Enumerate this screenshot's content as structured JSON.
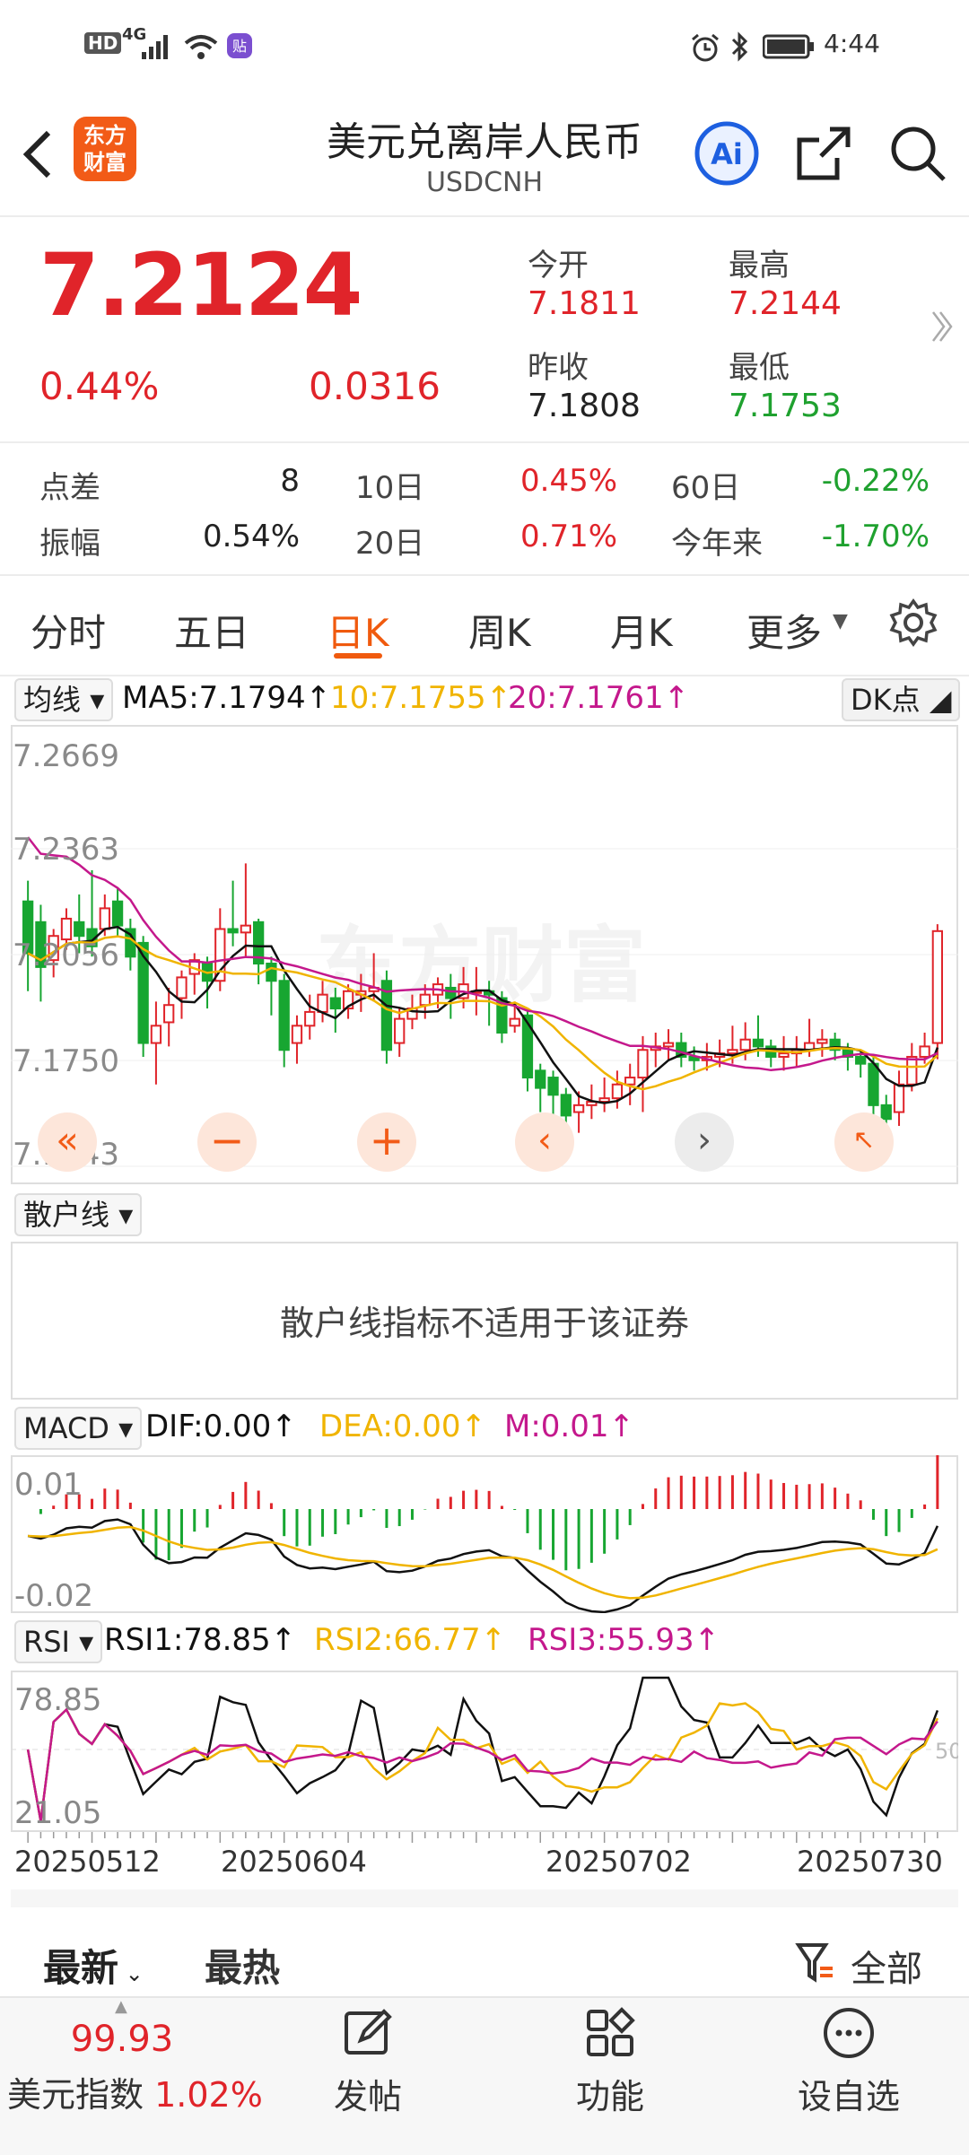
{
  "status_bar": {
    "left_icons": [
      "hd-icon",
      "4g-signal-icon",
      "wifi-icon",
      "app-notification-icon"
    ],
    "hd": "HD",
    "net": "4G",
    "right_icons": [
      "alarm-icon",
      "bluetooth-icon",
      "battery-icon"
    ],
    "time": "4:44"
  },
  "header": {
    "title": "美元兑离岸人民币",
    "subtitle": "USDCNH",
    "logo_line1": "东方",
    "logo_line2": "财富",
    "ai_label": "Ai"
  },
  "quote": {
    "price": "7.2124",
    "change_pct": "0.44%",
    "change_abs": "0.0316",
    "open_label": "今开",
    "open": "7.1811",
    "high_label": "最高",
    "high": "7.2144",
    "prev_label": "昨收",
    "prev": "7.1808",
    "low_label": "最低",
    "low": "7.1753"
  },
  "stats": {
    "spread_label": "点差",
    "spread": "8",
    "amp_label": "振幅",
    "amp": "0.54%",
    "d10_label": "10日",
    "d10": "0.45%",
    "d20_label": "20日",
    "d20": "0.71%",
    "d60_label": "60日",
    "d60": "-0.22%",
    "ytd_label": "今年来",
    "ytd": "-1.70%"
  },
  "tabs": [
    "分时",
    "五日",
    "日K",
    "周K",
    "月K",
    "更多"
  ],
  "active_tab": "日K",
  "kline": {
    "indicator_chip": "均线",
    "ma5": "MA5:7.1794",
    "ma10": "10:7.1755",
    "ma20": "20:7.1761",
    "dk_label": "DK点",
    "y_labels": [
      "7.2669",
      "7.2363",
      "7.2056",
      "7.1750",
      "7.1443"
    ],
    "watermark": "东方财富",
    "colors": {
      "up": "#e0242a",
      "down": "#17a631",
      "ma5": "#111111",
      "ma10": "#f0b400",
      "ma20": "#c4188c"
    }
  },
  "retail": {
    "chip": "散户线",
    "message": "散户线指标不适用于该证券"
  },
  "macd": {
    "chip": "MACD",
    "dif": "DIF:0.00",
    "dea": "DEA:0.00",
    "m": "M:0.01",
    "y_labels": [
      "0.01",
      "-0.02"
    ]
  },
  "rsi": {
    "chip": "RSI",
    "rsi1": "RSI1:78.85",
    "rsi2": "RSI2:66.77",
    "rsi3": "RSI3:55.93",
    "y_labels": [
      "78.85",
      "21.05"
    ],
    "mid_label": "50"
  },
  "dates": [
    "20250512",
    "20250604",
    "20250702",
    "20250730"
  ],
  "feed_tabs": {
    "latest": "最新",
    "hot": "最热",
    "filter": "全部"
  },
  "bottom_nav": {
    "index_value": "99.93",
    "index_name": "美元指数",
    "index_pct": "1.02%",
    "post": "发帖",
    "func": "功能",
    "watch": "设自选"
  },
  "chart_data": {
    "type": "candlestick",
    "x_start": "20250512",
    "x_end": "20250730",
    "ylim": [
      7.1443,
      7.2669
    ],
    "candles": [
      [
        7.221,
        7.206,
        7.227,
        7.195
      ],
      [
        7.215,
        7.202,
        7.22,
        7.192
      ],
      [
        7.204,
        7.211,
        7.213,
        7.199
      ],
      [
        7.21,
        7.216,
        7.219,
        7.207
      ],
      [
        7.215,
        7.211,
        7.223,
        7.206
      ],
      [
        7.213,
        7.208,
        7.23,
        7.205
      ],
      [
        7.213,
        7.219,
        7.223,
        7.211
      ],
      [
        7.221,
        7.214,
        7.225,
        7.211
      ],
      [
        7.213,
        7.205,
        7.216,
        7.201
      ],
      [
        7.209,
        7.18,
        7.211,
        7.176
      ],
      [
        7.18,
        7.185,
        7.192,
        7.168
      ],
      [
        7.186,
        7.191,
        7.196,
        7.179
      ],
      [
        7.193,
        7.199,
        7.201,
        7.187
      ],
      [
        7.2,
        7.204,
        7.206,
        7.194
      ],
      [
        7.203,
        7.198,
        7.205,
        7.19
      ],
      [
        7.198,
        7.213,
        7.219,
        7.195
      ],
      [
        7.213,
        7.212,
        7.227,
        7.208
      ],
      [
        7.212,
        7.214,
        7.232,
        7.205
      ],
      [
        7.215,
        7.203,
        7.216,
        7.197
      ],
      [
        7.203,
        7.198,
        7.205,
        7.188
      ],
      [
        7.198,
        7.178,
        7.2,
        7.173
      ],
      [
        7.18,
        7.185,
        7.188,
        7.174
      ],
      [
        7.185,
        7.189,
        7.194,
        7.181
      ],
      [
        7.189,
        7.194,
        7.198,
        7.186
      ],
      [
        7.193,
        7.19,
        7.196,
        7.183
      ],
      [
        7.19,
        7.195,
        7.197,
        7.187
      ],
      [
        7.194,
        7.195,
        7.2,
        7.189
      ],
      [
        7.195,
        7.196,
        7.206,
        7.192
      ],
      [
        7.198,
        7.178,
        7.201,
        7.174
      ],
      [
        7.18,
        7.187,
        7.19,
        7.176
      ],
      [
        7.187,
        7.19,
        7.194,
        7.184
      ],
      [
        7.191,
        7.194,
        7.197,
        7.187
      ],
      [
        7.194,
        7.197,
        7.199,
        7.19
      ],
      [
        7.196,
        7.193,
        7.2,
        7.187
      ],
      [
        7.193,
        7.197,
        7.202,
        7.19
      ],
      [
        7.195,
        7.195,
        7.202,
        7.188
      ],
      [
        7.195,
        7.194,
        7.198,
        7.185
      ],
      [
        7.193,
        7.183,
        7.195,
        7.18
      ],
      [
        7.185,
        7.187,
        7.192,
        7.183
      ],
      [
        7.188,
        7.17,
        7.19,
        7.166
      ],
      [
        7.172,
        7.167,
        7.174,
        7.16
      ],
      [
        7.17,
        7.165,
        7.172,
        7.159
      ],
      [
        7.165,
        7.159,
        7.167,
        7.153
      ],
      [
        7.16,
        7.162,
        7.166,
        7.154
      ],
      [
        7.162,
        7.163,
        7.168,
        7.158
      ],
      [
        7.163,
        7.164,
        7.17,
        7.16
      ],
      [
        7.164,
        7.168,
        7.172,
        7.161
      ],
      [
        7.168,
        7.17,
        7.174,
        7.162
      ],
      [
        7.17,
        7.178,
        7.182,
        7.16
      ],
      [
        7.178,
        7.179,
        7.183,
        7.173
      ],
      [
        7.179,
        7.18,
        7.184,
        7.175
      ],
      [
        7.18,
        7.176,
        7.183,
        7.173
      ],
      [
        7.176,
        7.175,
        7.179,
        7.172
      ],
      [
        7.175,
        7.176,
        7.18,
        7.172
      ],
      [
        7.176,
        7.177,
        7.181,
        7.173
      ],
      [
        7.177,
        7.178,
        7.185,
        7.174
      ],
      [
        7.178,
        7.181,
        7.186,
        7.175
      ],
      [
        7.181,
        7.179,
        7.188,
        7.176
      ],
      [
        7.179,
        7.176,
        7.181,
        7.173
      ],
      [
        7.176,
        7.177,
        7.182,
        7.172
      ],
      [
        7.177,
        7.178,
        7.182,
        7.173
      ],
      [
        7.178,
        7.18,
        7.187,
        7.176
      ],
      [
        7.18,
        7.181,
        7.184,
        7.176
      ],
      [
        7.181,
        7.178,
        7.183,
        7.175
      ],
      [
        7.178,
        7.176,
        7.18,
        7.172
      ],
      [
        7.176,
        7.174,
        7.178,
        7.17
      ],
      [
        7.174,
        7.162,
        7.176,
        7.158
      ],
      [
        7.162,
        7.158,
        7.165,
        7.152
      ],
      [
        7.16,
        7.168,
        7.172,
        7.156
      ],
      [
        7.168,
        7.176,
        7.18,
        7.166
      ],
      [
        7.176,
        7.179,
        7.183,
        7.174
      ],
      [
        7.18,
        7.2124,
        7.2144,
        7.1753
      ]
    ],
    "ma5_last": 7.1794,
    "ma10_last": 7.1755,
    "ma20_last": 7.1761
  }
}
